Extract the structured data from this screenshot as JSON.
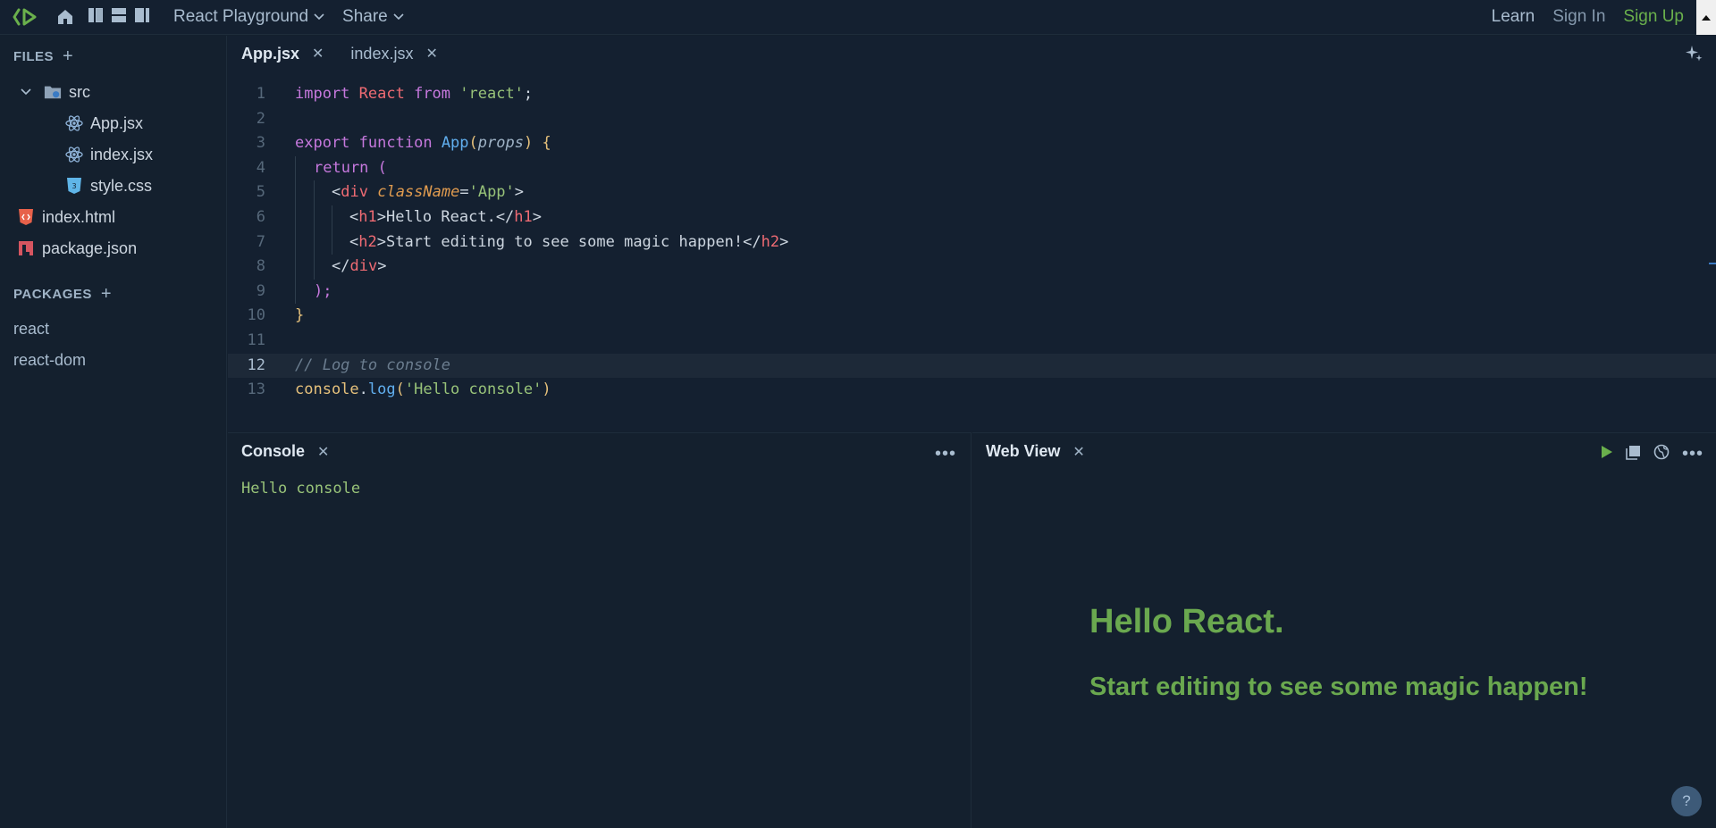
{
  "topbar": {
    "project_menu": "React Playground",
    "share_menu": "Share",
    "learn": "Learn",
    "sign_in": "Sign In",
    "sign_up": "Sign Up"
  },
  "sidebar": {
    "files_title": "FILES",
    "files": [
      {
        "name": "src",
        "icon": "folder-icon"
      },
      {
        "name": "App.jsx",
        "icon": "react-icon"
      },
      {
        "name": "index.jsx",
        "icon": "react-icon"
      },
      {
        "name": "style.css",
        "icon": "css-icon"
      },
      {
        "name": "index.html",
        "icon": "html-icon"
      },
      {
        "name": "package.json",
        "icon": "npm-icon"
      }
    ],
    "packages_title": "PACKAGES",
    "packages": [
      "react",
      "react-dom"
    ]
  },
  "editor": {
    "tabs": [
      {
        "label": "App.jsx",
        "active": true
      },
      {
        "label": "index.jsx",
        "active": false
      }
    ],
    "line_numbers": [
      "1",
      "2",
      "3",
      "4",
      "5",
      "6",
      "7",
      "8",
      "9",
      "10",
      "11",
      "12",
      "13"
    ],
    "code": {
      "l1": [
        "import",
        " React ",
        "from",
        " 'react'",
        ";"
      ],
      "l3": [
        "export",
        " ",
        "function",
        " ",
        "App",
        "(",
        "props",
        ")",
        " {"
      ],
      "l4": [
        "return",
        " ("
      ],
      "l5": [
        "<",
        "div",
        " ",
        "className",
        "=",
        "'App'",
        ">"
      ],
      "l6": [
        "<",
        "h1",
        ">",
        "Hello React.",
        "</",
        "h1",
        ">"
      ],
      "l7": [
        "<",
        "h2",
        ">",
        "Start editing to see some magic happen!",
        "</",
        "h2",
        ">"
      ],
      "l8": [
        "</",
        "div",
        ">"
      ],
      "l9": [
        ");"
      ],
      "l10": [
        "}"
      ],
      "l12": [
        "// Log to console"
      ],
      "l13": [
        "console",
        ".",
        "log",
        "(",
        "'Hello console'",
        ")"
      ]
    }
  },
  "console": {
    "title": "Console",
    "output": "Hello console"
  },
  "webview": {
    "title": "Web View",
    "h1": "Hello React.",
    "h2": "Start editing to see some magic happen!"
  },
  "help_label": "?",
  "colors": {
    "background": "#14202e",
    "accent_green": "#6ab04c",
    "keyword": "#c678dd",
    "string": "#98c379",
    "function": "#61afef",
    "tag": "#ef6b73"
  }
}
